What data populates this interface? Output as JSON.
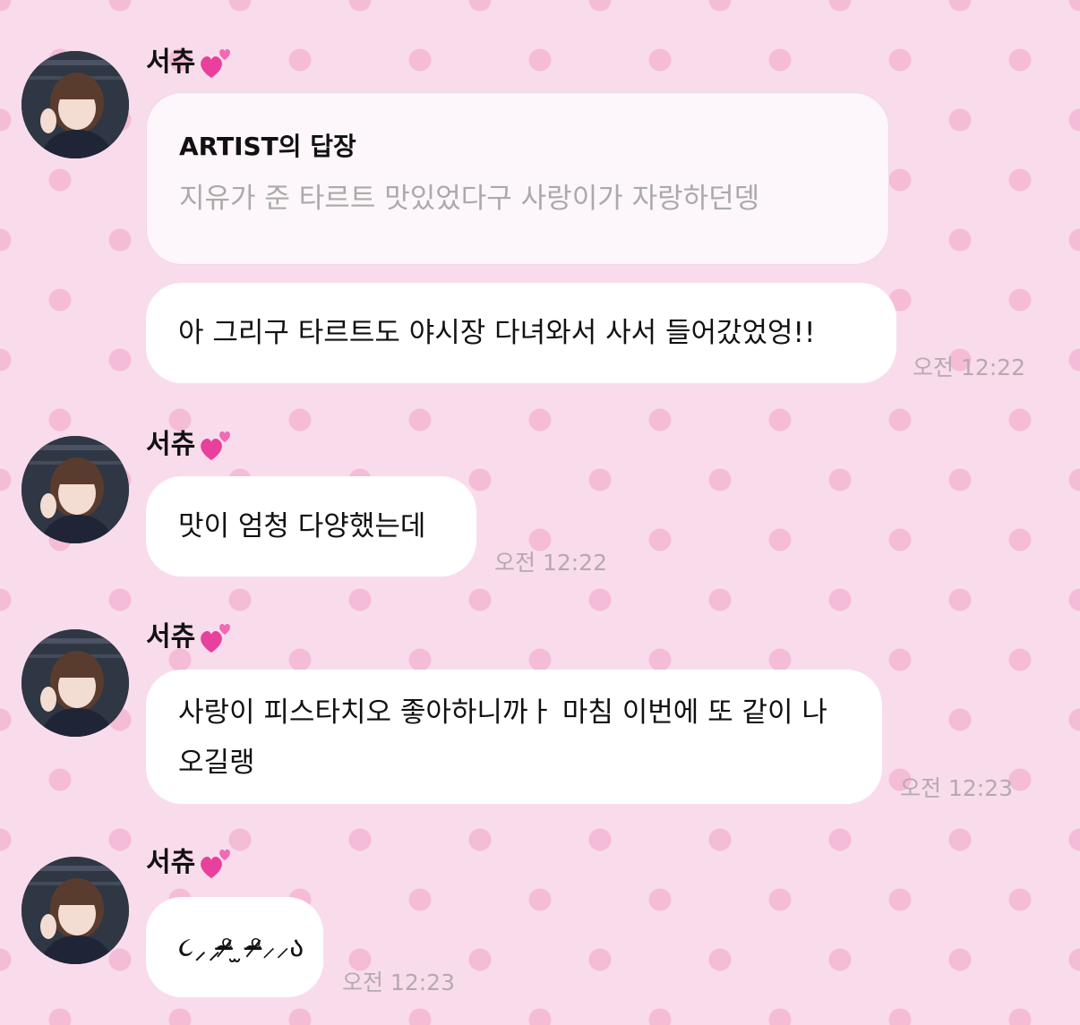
{
  "messages": [
    {
      "sender": "서츄",
      "reply_label": "ARTIST의 답장",
      "reply_text": "지유가 준 타르트 맛있었다구 사랑이가 자랑하던뎅",
      "text": "아 그리구 타르트도 야시장 다녀와서 사서 들어갔었엉!!",
      "time": "오전 12:22"
    },
    {
      "sender": "서츄",
      "text": "맛이 엄청 다양했는데",
      "time": "오전 12:22"
    },
    {
      "sender": "서츄",
      "text": "사랑이 피스타치오 좋아하니까ㅏ 마침 이번에 또 같이 나오길랭",
      "time": "오전 12:23"
    },
    {
      "sender": "서츄",
      "text": "૮⸝⸝ᵒ̴̶̷ ̫ ᵒ̴̶̷⸝⸝ა",
      "time": "오전 12:23"
    }
  ],
  "icons": {
    "sender_badge": "two-hearts-icon",
    "avatar": "avatar-photo"
  },
  "colors": {
    "background": "#f9dcec",
    "dots": "#f4bcd6",
    "bubble": "#ffffff",
    "timestamp": "#b5a9b0",
    "heart": "#e8409c"
  }
}
